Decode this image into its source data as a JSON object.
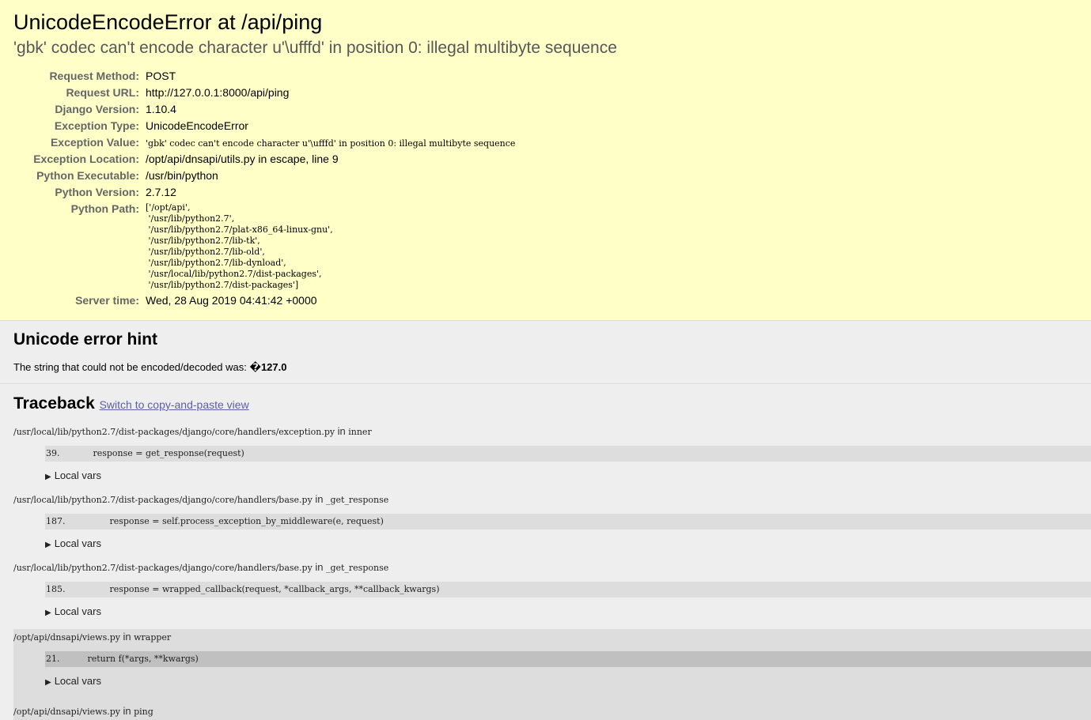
{
  "summary": {
    "title": "UnicodeEncodeError at /api/ping",
    "subtitle": "'gbk' codec can't encode character u'\\ufffd' in position 0: illegal multibyte sequence",
    "meta": [
      {
        "label": "Request Method:",
        "value": "POST"
      },
      {
        "label": "Request URL:",
        "value": "http://127.0.0.1:8000/api/ping"
      },
      {
        "label": "Django Version:",
        "value": "1.10.4"
      },
      {
        "label": "Exception Type:",
        "value": "UnicodeEncodeError"
      },
      {
        "label": "Exception Value:",
        "value": "'gbk' codec can't encode character u'\\ufffd' in position 0: illegal multibyte sequence"
      },
      {
        "label": "Exception Location:",
        "value": "/opt/api/dnsapi/utils.py in escape, line 9"
      },
      {
        "label": "Python Executable:",
        "value": "/usr/bin/python"
      },
      {
        "label": "Python Version:",
        "value": "2.7.12"
      },
      {
        "label": "Python Path:",
        "value": [
          "['/opt/api',",
          " '/usr/lib/python2.7',",
          " '/usr/lib/python2.7/plat-x86_64-linux-gnu',",
          " '/usr/lib/python2.7/lib-tk',",
          " '/usr/lib/python2.7/lib-old',",
          " '/usr/lib/python2.7/lib-dynload',",
          " '/usr/local/lib/python2.7/dist-packages',",
          " '/usr/lib/python2.7/dist-packages']"
        ]
      },
      {
        "label": "Server time:",
        "value": "Wed, 28 Aug 2019 04:41:42 +0000"
      }
    ]
  },
  "unicode_hint": {
    "heading": "Unicode error hint",
    "text": "The string that could not be encoded/decoded was: ",
    "value": "�127.0"
  },
  "traceback": {
    "heading": "Traceback",
    "switch_link": "Switch to copy-and-paste view",
    "in_word": "in",
    "local_vars_label": "Local vars",
    "frames": [
      {
        "file": "/usr/local/lib/python2.7/dist-packages/django/core/handlers/exception.py",
        "func": "inner",
        "code": "39.            response = get_response(request)"
      },
      {
        "file": "/usr/local/lib/python2.7/dist-packages/django/core/handlers/base.py",
        "func": "_get_response",
        "code": "187.                response = self.process_exception_by_middleware(e, request)"
      },
      {
        "file": "/usr/local/lib/python2.7/dist-packages/django/core/handlers/base.py",
        "func": "_get_response",
        "code": "185.                response = wrapped_callback(request, *callback_args, **callback_kwargs)"
      },
      {
        "file": "/opt/api/dnsapi/views.py",
        "func": "wrapper",
        "code": "21.          return f(*args, **kwargs)"
      },
      {
        "file": "/opt/api/dnsapi/views.py",
        "func": "ping"
      }
    ]
  },
  "colors": {
    "summary_bg": "#ffffc8",
    "page_bg": "#eeeeee",
    "code_bg": "#dddddd",
    "user_code_bg": "#c0c0c0",
    "link": "#5b5fa8"
  }
}
